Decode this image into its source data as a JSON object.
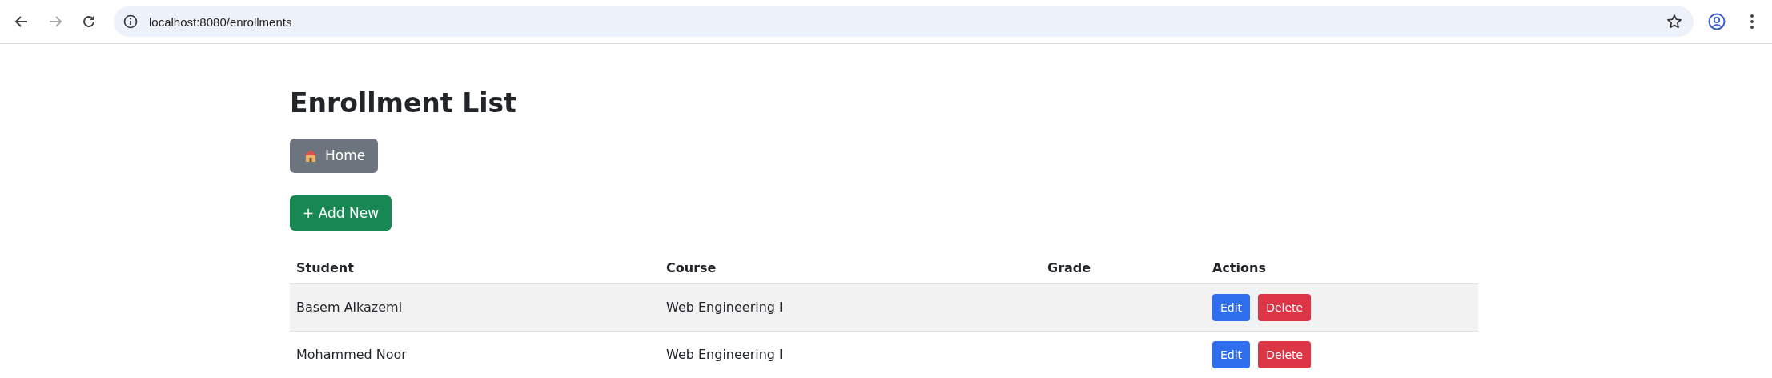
{
  "browser": {
    "url": "localhost:8080/enrollments"
  },
  "page": {
    "title": "Enrollment List",
    "home_button": "Home",
    "add_button": "+ Add New"
  },
  "table": {
    "columns": [
      "Student",
      "Course",
      "Grade",
      "Actions"
    ],
    "rows": [
      {
        "student": "Basem Alkazemi",
        "course": "Web Engineering I",
        "actions": [
          "Edit",
          "Delete"
        ]
      },
      {
        "student": "Mohammed Noor",
        "course": "Web Engineering I",
        "actions": [
          "Edit",
          "Delete"
        ]
      }
    ]
  }
}
